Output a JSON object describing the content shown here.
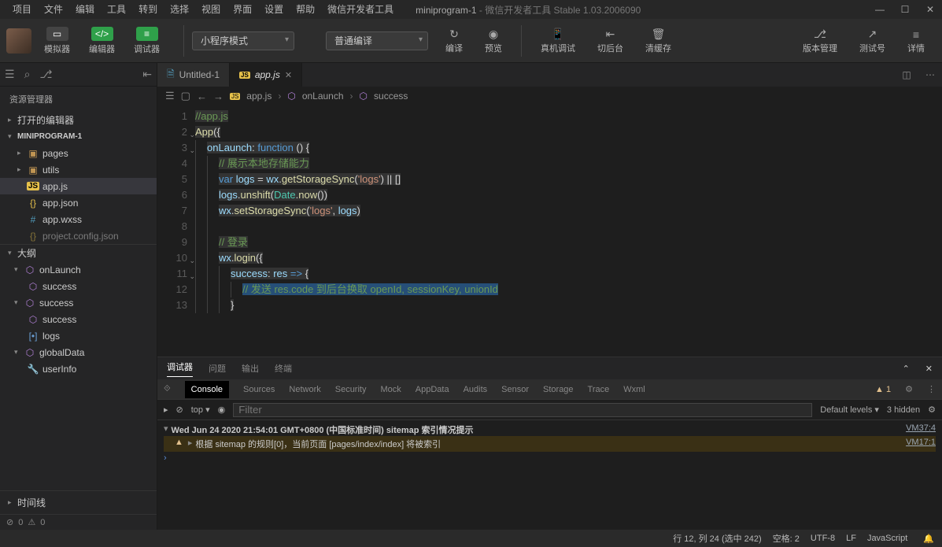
{
  "menu": {
    "items": [
      "项目",
      "文件",
      "编辑",
      "工具",
      "转到",
      "选择",
      "视图",
      "界面",
      "设置",
      "帮助",
      "微信开发者工具"
    ],
    "app_name": "miniprogram-1",
    "app_subtitle": " - 微信开发者工具 Stable 1.03.2006090"
  },
  "toolbar": {
    "simulator": "模拟器",
    "editor": "编辑器",
    "debugger": "调试器",
    "mode_select": "小程序模式",
    "compile_select": "普通编译",
    "compile": "编译",
    "preview": "预览",
    "remote_debug": "真机调试",
    "background": "切后台",
    "clear_cache": "清缓存",
    "version_manage": "版本管理",
    "test_account": "测试号",
    "details": "详情"
  },
  "tabs": {
    "tab1": "Untitled-1",
    "tab2": "app.js"
  },
  "breadcrumb": {
    "file": "app.js",
    "fn1": "onLaunch",
    "fn2": "success"
  },
  "explorer": {
    "title": "资源管理器",
    "open_editors": "打开的编辑器",
    "project_name": "MINIPROGRAM-1",
    "pages": "pages",
    "utils": "utils",
    "appjs": "app.js",
    "appjson": "app.json",
    "appwxss": "app.wxss",
    "projconfig": "project.config.json",
    "outline_title": "大纲",
    "outline": {
      "onLaunch": "onLaunch",
      "success1": "success",
      "success2": "success",
      "success3": "success",
      "logs": "logs",
      "globalData": "globalData",
      "userInfo": "userInfo"
    },
    "timeline": "时间线",
    "errors": "0",
    "warnings": "0"
  },
  "code": {
    "l1": "//app.js",
    "l2_app": "App",
    "l3_onlaunch": "onLaunch",
    "l3_function": "function",
    "l4": "// 展示本地存储能力",
    "l5_var": "var",
    "l5_logs": "logs",
    "l5_wx": "wx",
    "l5_call": "getStorageSync",
    "l5_str": "'logs'",
    "l6_logs": "logs",
    "l6_call": "unshift",
    "l6_date": "Date",
    "l6_now": "now",
    "l7_wx": "wx",
    "l7_call": "setStorageSync",
    "l7_str": "'logs'",
    "l7_logs": "logs",
    "l9": "// 登录",
    "l10_wx": "wx",
    "l10_call": "login",
    "l11_success": "success",
    "l11_res": "res",
    "l12": "// 发送 res.code 到后台换取 openId, sessionKey, unionId"
  },
  "debug": {
    "tabs": {
      "debugger": "调试器",
      "problems": "问题",
      "output": "输出",
      "terminal": "终端"
    },
    "devtabs": {
      "console": "Console",
      "sources": "Sources",
      "network": "Network",
      "security": "Security",
      "mock": "Mock",
      "appdata": "AppData",
      "audits": "Audits",
      "sensor": "Sensor",
      "storage": "Storage",
      "trace": "Trace",
      "wxml": "Wxml"
    },
    "warn_count": "1",
    "filter_top": "top",
    "filter_placeholder": "Filter",
    "filter_levels": "Default levels",
    "hidden": "3 hidden",
    "line1": "Wed Jun 24 2020 21:54:01 GMT+0800 (中国标准时间) sitemap 索引情况提示",
    "line1_src": "VM37:4",
    "line2": "根据 sitemap 的规则[0]，当前页面 [pages/index/index] 将被索引",
    "line2_src": "VM17:1"
  },
  "status": {
    "cursor": "行 12, 列 24 (选中 242)",
    "spaces": "空格: 2",
    "encoding": "UTF-8",
    "eol": "LF",
    "lang": "JavaScript"
  }
}
